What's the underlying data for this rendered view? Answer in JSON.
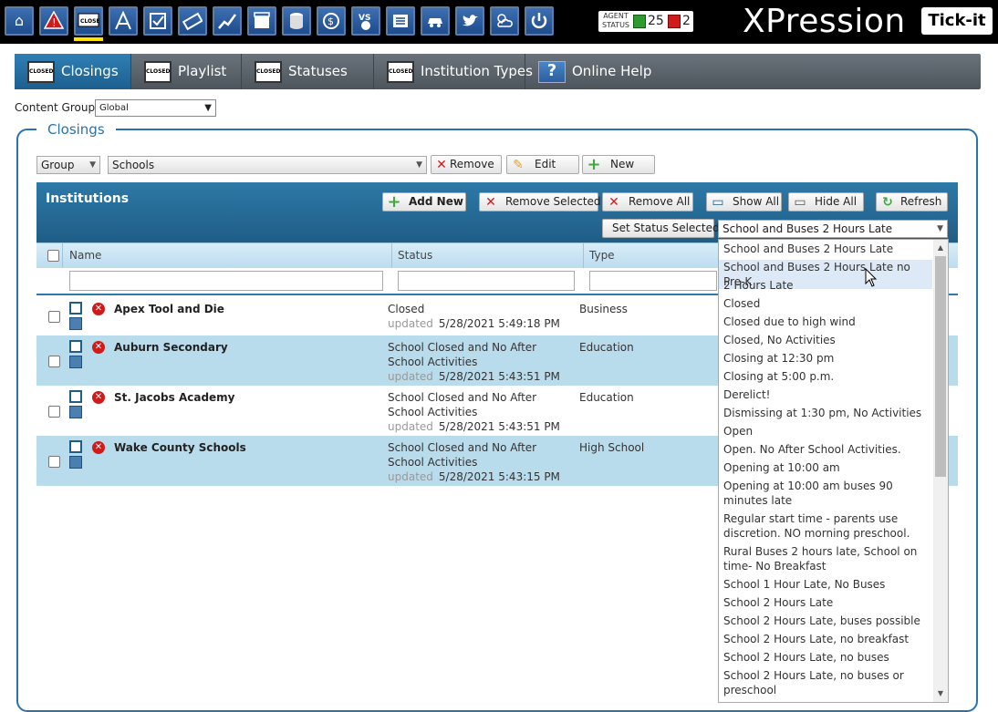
{
  "topbar": {
    "icons": [
      "home-icon",
      "warning-icon",
      "closed-sign-icon",
      "compass-icon",
      "checklist-icon",
      "ticket-icon",
      "stock-chart-icon",
      "film-icon",
      "database-icon",
      "money-icon",
      "versus-icon",
      "newspaper-icon",
      "car-icon",
      "twitter-icon",
      "weather-icon",
      "power-icon"
    ],
    "agent_status_label": "AGENT STATUS",
    "agent_green_count": "25",
    "agent_red_count": "2",
    "brand": "XPression",
    "badge": "Tick-it"
  },
  "nav": {
    "tabs": [
      {
        "label": "Closings",
        "icon": "CLOSED"
      },
      {
        "label": "Playlist",
        "icon": "CLOSED"
      },
      {
        "label": "Statuses",
        "icon": "CLOSED"
      },
      {
        "label": "Institution Types",
        "icon": "CLOSED"
      },
      {
        "label": "Online Help",
        "icon": "?"
      }
    ]
  },
  "content_group": {
    "label": "Content Group:",
    "value": "Global"
  },
  "closings": {
    "legend": "Closings",
    "group_select": "Group",
    "schools_select": "Schools",
    "remove_label": "Remove",
    "edit_label": "Edit",
    "new_label": "New"
  },
  "institutions": {
    "title": "Institutions",
    "add_new": "Add New",
    "remove_selected": "Remove Selected",
    "remove_all": "Remove All",
    "show_all": "Show All",
    "hide_all": "Hide All",
    "refresh": "Refresh",
    "set_status_selected": "Set Status Selected",
    "status_select_value": "School and Buses 2 Hours Late",
    "columns": [
      "Name",
      "Status",
      "Type"
    ],
    "updated_label": "updated",
    "rows": [
      {
        "name": "Apex Tool and Die",
        "status": "Closed",
        "updated": "5/28/2021 5:49:18 PM",
        "type": "Business"
      },
      {
        "name": "Auburn Secondary",
        "status": "School Closed and No After School Activities",
        "updated": "5/28/2021 5:43:51 PM",
        "type": "Education"
      },
      {
        "name": "St. Jacobs Academy",
        "status": "School Closed and No After School Activities",
        "updated": "5/28/2021 5:43:51 PM",
        "type": "Education"
      },
      {
        "name": "Wake County Schools",
        "status": "School Closed and No After School Activities",
        "updated": "5/28/2021 5:43:15 PM",
        "type": "High School"
      }
    ]
  },
  "status_options": [
    "School and Buses 2 Hours Late",
    "School and Buses 2 Hours Late no Pre-K",
    "2 Hours Late",
    "Closed",
    "Closed due to high wind",
    "Closed, No Activities",
    "Closing at 12:30 pm",
    "Closing at 5:00 p.m.",
    "Derelict!",
    "Dismissing at 1:30 pm, No Activities",
    "Open",
    "Open. No After School Activities.",
    "Opening at 10:00 am",
    "Opening at 10:00 am buses 90 minutes late",
    "Regular start time - parents use discretion. NO morning preschool.",
    "Rural Buses 2 hours late, School on time- No Breakfast",
    "School 1 Hour Late, No Buses",
    "School 2 Hours Late",
    "School 2 Hours Late, buses possible",
    "School 2 Hours Late, no breakfast",
    "School 2 Hours Late, no buses",
    "School 2 Hours Late, no buses or preschool"
  ],
  "colors": {
    "accent": "#2a72ad",
    "row_alt": "#b9dcec",
    "nav_active": "#2f7fb4"
  }
}
